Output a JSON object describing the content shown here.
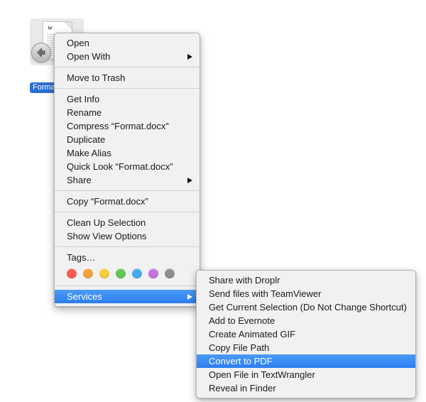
{
  "desktop": {
    "file": {
      "name_label": "Forma",
      "doc_logo": "W",
      "icon_name": "document-icon",
      "badge_icon": "alias-arrow-badge",
      "selection_color": "#2b6fd4"
    }
  },
  "context_menu": {
    "groups": [
      {
        "items": [
          {
            "label": "Open",
            "submenu": false
          },
          {
            "label": "Open With",
            "submenu": true
          }
        ]
      },
      {
        "items": [
          {
            "label": "Move to Trash",
            "submenu": false
          }
        ]
      },
      {
        "items": [
          {
            "label": "Get Info",
            "submenu": false
          },
          {
            "label": "Rename",
            "submenu": false
          },
          {
            "label": "Compress “Format.docx”",
            "submenu": false
          },
          {
            "label": "Duplicate",
            "submenu": false
          },
          {
            "label": "Make Alias",
            "submenu": false
          },
          {
            "label": "Quick Look “Format.docx”",
            "submenu": false
          },
          {
            "label": "Share",
            "submenu": true
          }
        ]
      },
      {
        "items": [
          {
            "label": "Copy “Format.docx”",
            "submenu": false
          }
        ]
      },
      {
        "items": [
          {
            "label": "Clean Up Selection",
            "submenu": false
          },
          {
            "label": "Show View Options",
            "submenu": false
          }
        ]
      },
      {
        "items": [
          {
            "label": "Tags…",
            "submenu": false
          }
        ]
      }
    ],
    "tags": {
      "label": "Tags…",
      "colors": [
        {
          "name": "red",
          "hex": "#fb5b52"
        },
        {
          "name": "orange",
          "hex": "#f6a23a"
        },
        {
          "name": "yellow",
          "hex": "#f6ce3f"
        },
        {
          "name": "green",
          "hex": "#62c554"
        },
        {
          "name": "blue",
          "hex": "#45acf0"
        },
        {
          "name": "purple",
          "hex": "#c372e0"
        },
        {
          "name": "gray",
          "hex": "#8e8e8e"
        }
      ]
    },
    "services": {
      "label": "Services",
      "highlighted": true,
      "highlight_color": "#2d7df0"
    }
  },
  "services_submenu": {
    "items": [
      {
        "label": "Share with Droplr",
        "highlighted": false
      },
      {
        "label": "Send files with TeamViewer",
        "highlighted": false
      },
      {
        "label": "Get Current Selection (Do Not Change Shortcut)",
        "highlighted": false
      },
      {
        "label": "Add to Evernote",
        "highlighted": false
      },
      {
        "label": "Create Animated GIF",
        "highlighted": false
      },
      {
        "label": "Copy File Path",
        "highlighted": false
      },
      {
        "label": "Convert to PDF",
        "highlighted": true
      },
      {
        "label": "Open File in TextWrangler",
        "highlighted": false
      },
      {
        "label": "Reveal in Finder",
        "highlighted": false
      }
    ],
    "highlight_color": "#2d7df0"
  }
}
